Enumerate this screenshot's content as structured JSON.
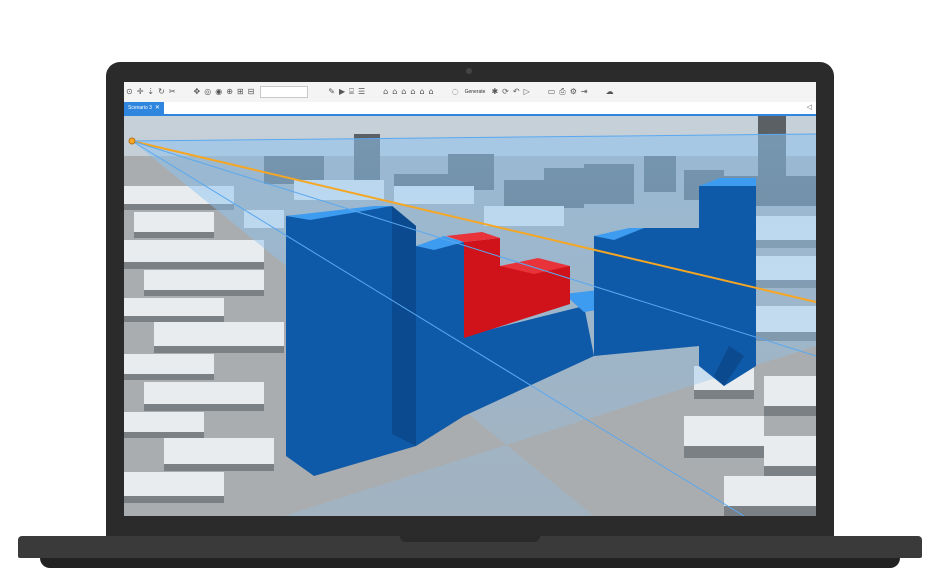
{
  "toolbar": {
    "left_icons": [
      "⊙",
      "✛",
      "⇣",
      "↻",
      "✂"
    ],
    "nav_icons": [
      "✥",
      "◎",
      "◉",
      "⊕",
      "⊞",
      "⊟"
    ],
    "sketch_icons": [
      "✎",
      "▶",
      "⌸",
      "☰"
    ],
    "building_icons": [
      "⌂",
      "⌂",
      "⌂",
      "⌂",
      "⌂",
      "⌂"
    ],
    "generate_label": "Generate",
    "gen_icons": [
      "✱",
      "⟳",
      "↶",
      "▷"
    ],
    "right_icons": [
      "▭",
      "⎙",
      "⚙",
      "⇥"
    ],
    "far_icon": "☁"
  },
  "tab": {
    "label": "Scenario 3",
    "close": "✕"
  },
  "corner_icon": "◁",
  "colors": {
    "bezel": "#2b2b2c",
    "accent": "#2e86de",
    "block_front": "#0f5aa8",
    "block_top": "#3d9bf0",
    "red": "#d0121a",
    "sightline": "#f5a623"
  }
}
